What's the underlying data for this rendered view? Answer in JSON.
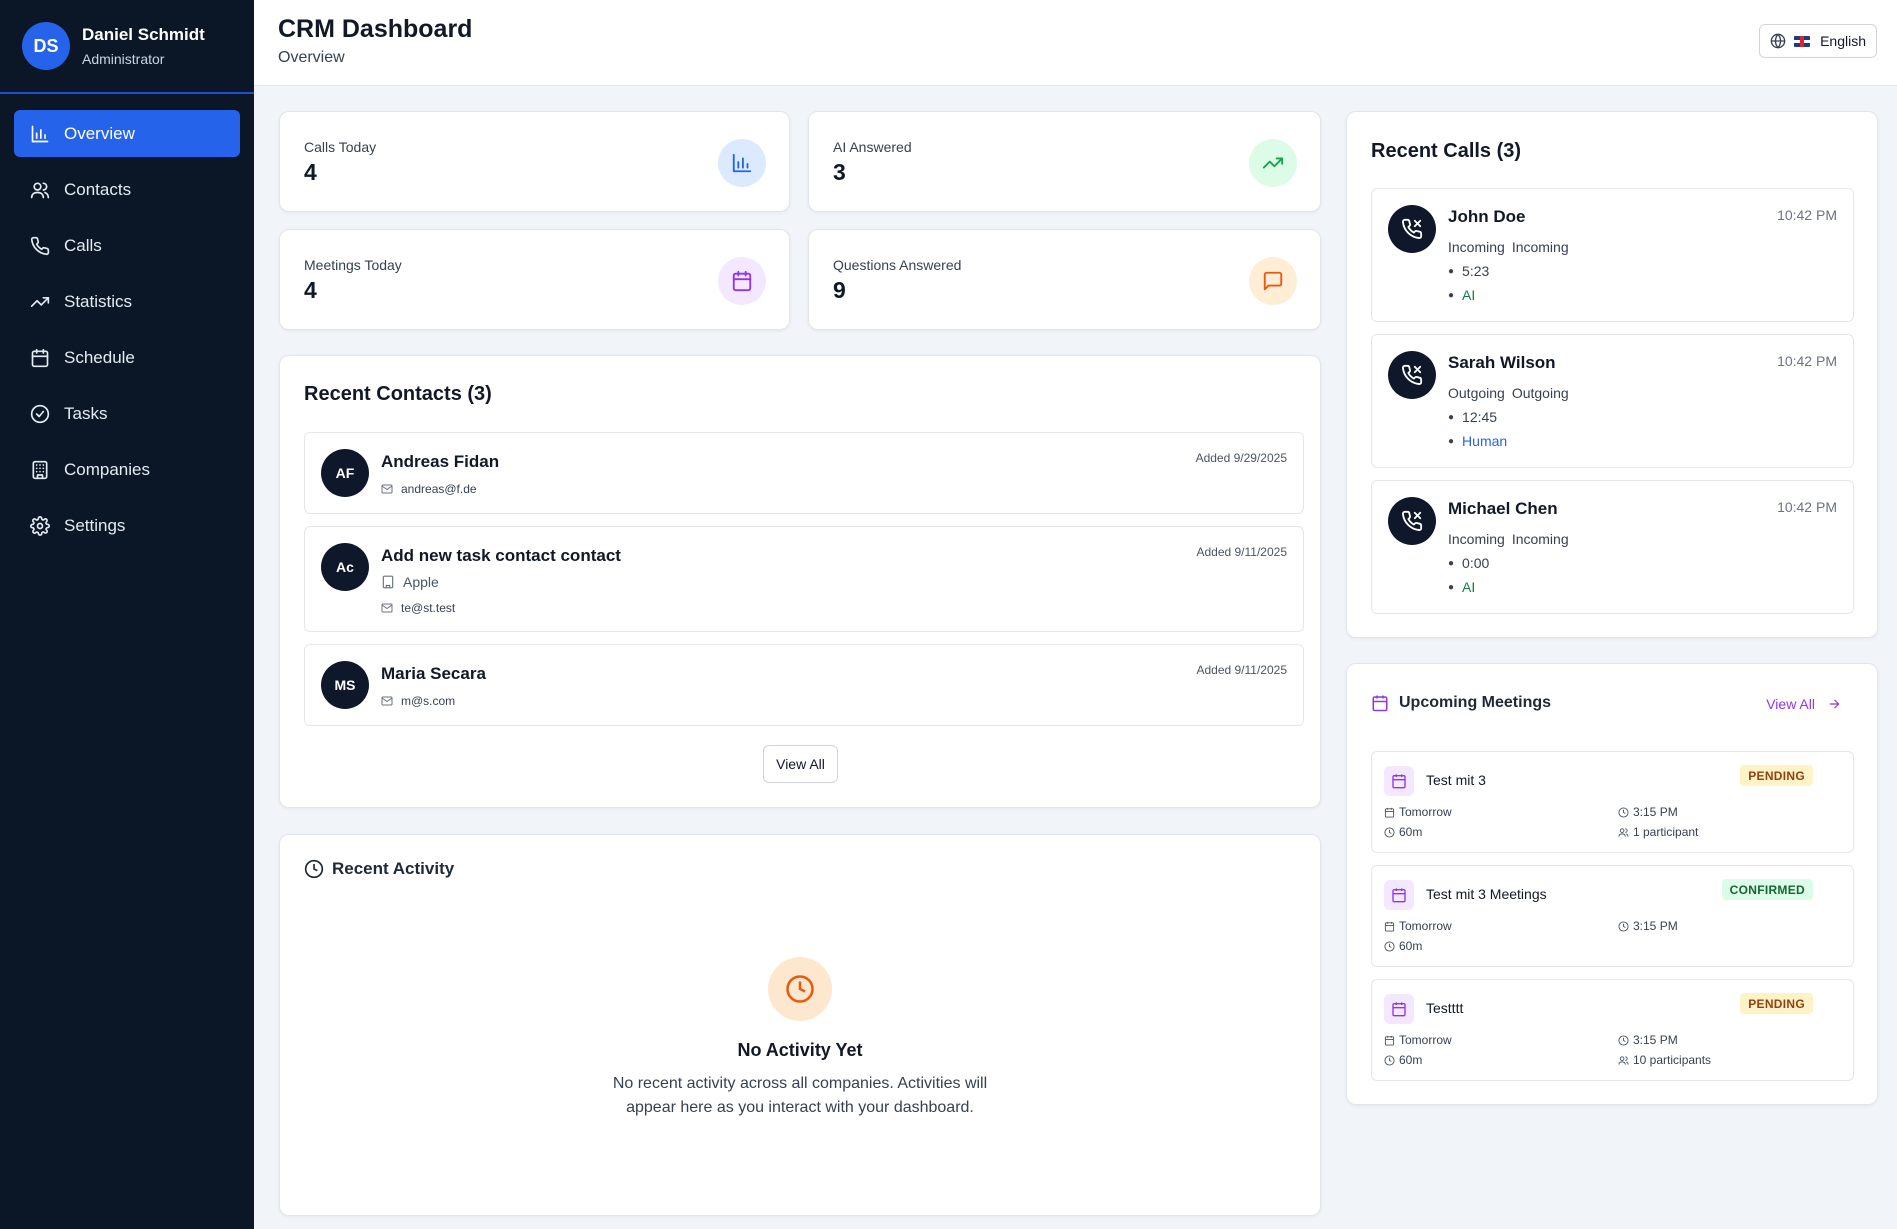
{
  "user": {
    "initials": "DS",
    "name": "Daniel Schmidt",
    "role": "Administrator"
  },
  "nav": [
    {
      "label": "Overview",
      "icon": "bar-chart-icon",
      "active": true
    },
    {
      "label": "Contacts",
      "icon": "users-icon"
    },
    {
      "label": "Calls",
      "icon": "phone-icon"
    },
    {
      "label": "Statistics",
      "icon": "trending-up-icon"
    },
    {
      "label": "Schedule",
      "icon": "calendar-icon"
    },
    {
      "label": "Tasks",
      "icon": "check-circle-icon"
    },
    {
      "label": "Companies",
      "icon": "building-icon"
    },
    {
      "label": "Settings",
      "icon": "gear-icon"
    }
  ],
  "header": {
    "title": "CRM Dashboard",
    "subtitle": "Overview",
    "language": "English"
  },
  "stats": [
    {
      "label": "Calls Today",
      "value": "4",
      "icon": "bar-chart-icon",
      "color": "#2563eb",
      "bg": "#dbeafe"
    },
    {
      "label": "AI Answered",
      "value": "3",
      "icon": "trending-up-icon",
      "color": "#16a34a",
      "bg": "#dcfce7"
    },
    {
      "label": "Meetings Today",
      "value": "4",
      "icon": "calendar-icon",
      "color": "#9333ea",
      "bg": "#f3e8ff"
    },
    {
      "label": "Questions Answered",
      "value": "9",
      "icon": "message-icon",
      "color": "#ea580c",
      "bg": "#ffedd5"
    }
  ],
  "contacts": {
    "title": "Recent Contacts (3)",
    "view_all": "View All",
    "items": [
      {
        "initials": "AF",
        "name": "Andreas Fidan",
        "company": "",
        "email": "andreas@f.de",
        "added": "Added 9/29/2025"
      },
      {
        "initials": "Ac",
        "name": "Add new task contact contact",
        "company": "Apple",
        "email": "te@st.test",
        "added": "Added 9/11/2025"
      },
      {
        "initials": "MS",
        "name": "Maria Secara",
        "company": "",
        "email": "m@s.com",
        "added": "Added 9/11/2025"
      }
    ]
  },
  "activity": {
    "title": "Recent Activity",
    "empty_title": "No Activity Yet",
    "empty_desc": "No recent activity across all companies. Activities will appear here as you interact with your dashboard."
  },
  "calls": {
    "title": "Recent Calls (3)",
    "items": [
      {
        "name": "John Doe",
        "time": "10:42 PM",
        "dir1": "Incoming",
        "dir2": "Incoming",
        "duration": "5:23",
        "handler": "AI",
        "handler_color": "#15803d"
      },
      {
        "name": "Sarah Wilson",
        "time": "10:42 PM",
        "dir1": "Outgoing",
        "dir2": "Outgoing",
        "duration": "12:45",
        "handler": "Human",
        "handler_color": "#2563eb"
      },
      {
        "name": "Michael Chen",
        "time": "10:42 PM",
        "dir1": "Incoming",
        "dir2": "Incoming",
        "duration": "0:00",
        "handler": "AI",
        "handler_color": "#15803d"
      }
    ]
  },
  "meetings": {
    "title": "Upcoming Meetings",
    "view_all": "View All",
    "items": [
      {
        "title": "Test mit 3",
        "status": "PENDING",
        "day": "Tomorrow",
        "time": "3:15 PM",
        "duration": "60m",
        "participants": "1 participant"
      },
      {
        "title": "Test mit 3 Meetings",
        "status": "CONFIRMED",
        "day": "Tomorrow",
        "time": "3:15 PM",
        "duration": "60m",
        "participants": ""
      },
      {
        "title": "Testttt",
        "status": "PENDING",
        "day": "Tomorrow",
        "time": "3:15 PM",
        "duration": "60m",
        "participants": "10 participants"
      }
    ]
  }
}
